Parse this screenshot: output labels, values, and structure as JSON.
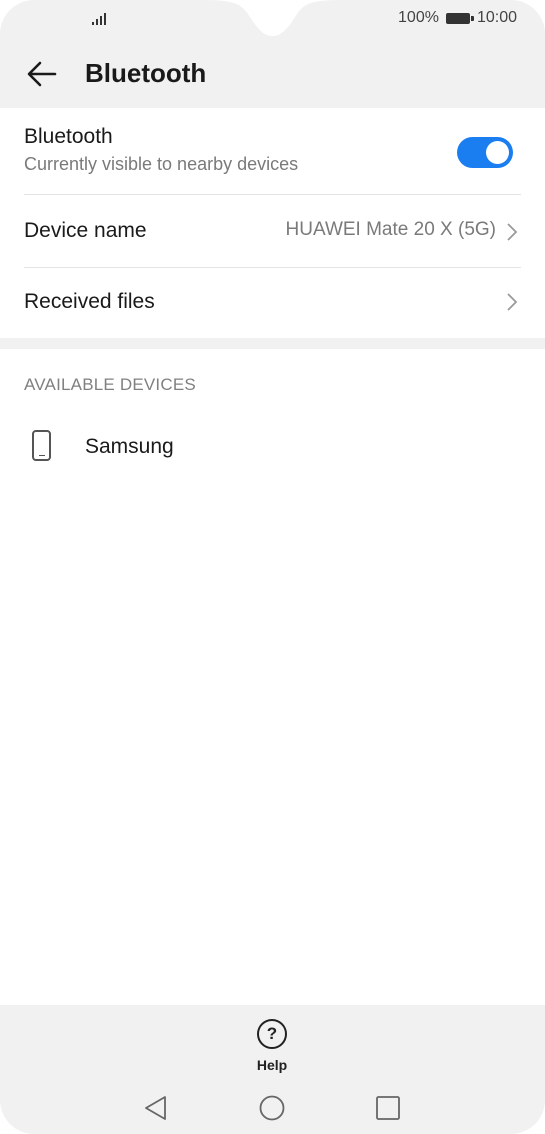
{
  "status_bar": {
    "battery_percent": "100%",
    "time": "10:00",
    "signal_icon": "signal-icon",
    "battery_icon": "battery-icon"
  },
  "header": {
    "title": "Bluetooth",
    "back_icon": "back-arrow-icon"
  },
  "bluetooth_setting": {
    "title": "Bluetooth",
    "subtitle": "Currently visible to nearby devices",
    "enabled": true,
    "accent_color": "#1a7ef0"
  },
  "device_name_setting": {
    "title": "Device name",
    "value": "HUAWEI Mate 20 X (5G)"
  },
  "received_files_setting": {
    "title": "Received files"
  },
  "available_devices": {
    "section_label": "AVAILABLE DEVICES",
    "devices": [
      {
        "name": "Samsung",
        "icon": "phone-icon"
      }
    ]
  },
  "bottom_bar": {
    "help_label": "Help",
    "help_icon": "help-icon"
  },
  "nav_bar": {
    "back_icon": "nav-back-icon",
    "home_icon": "nav-home-icon",
    "recents_icon": "nav-recents-icon"
  }
}
